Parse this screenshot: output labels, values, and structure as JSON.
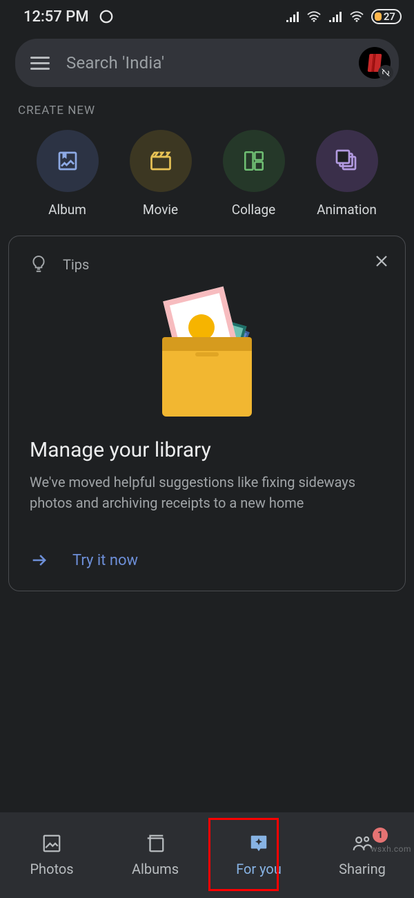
{
  "status": {
    "time": "12:57 PM",
    "battery_percent": "27"
  },
  "search": {
    "placeholder": "Search 'India'"
  },
  "section_heading": "CREATE NEW",
  "create": {
    "items": [
      {
        "label": "Album"
      },
      {
        "label": "Movie"
      },
      {
        "label": "Collage"
      },
      {
        "label": "Animation"
      }
    ]
  },
  "tips": {
    "heading": "Tips",
    "title": "Manage your library",
    "body": "We've moved helpful suggestions like fixing sideways photos and archiving receipts to a new home",
    "cta": "Try it now"
  },
  "nav": {
    "items": [
      {
        "label": "Photos"
      },
      {
        "label": "Albums"
      },
      {
        "label": "For you"
      },
      {
        "label": "Sharing",
        "badge": "1"
      }
    ],
    "active_index": 2
  },
  "watermark": "wsxh.com",
  "colors": {
    "accent_blue": "#6d8fd8",
    "active_tab": "#87b3e4",
    "card_border": "#4a4c50",
    "badge": "#e57373"
  }
}
